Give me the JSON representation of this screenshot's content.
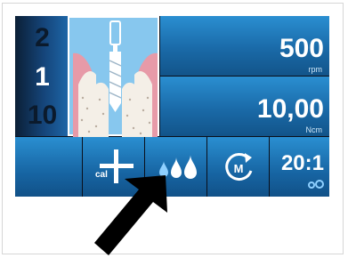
{
  "programs": {
    "top": "2",
    "middle": "1",
    "bottom": "10"
  },
  "speed": {
    "value": "500",
    "unit": "rpm"
  },
  "torque": {
    "value": "10,00",
    "unit": "Ncm"
  },
  "toolbar": {
    "calibration_label": "cal",
    "ratio_value": "20:1"
  },
  "icons": {
    "calibration": "cal-plus-icon",
    "irrigation": "irrigation-drops-icon",
    "motor": "motor-rotation-icon",
    "ratio_settings": "settings-gears-icon",
    "pointer": "pointer-arrow-icon"
  },
  "colors": {
    "panel_blue": "#1e7ac0",
    "screen_bg": "#0a0f1a",
    "illustration_bg": "#87c7ee",
    "gum_pink": "#e79aa8",
    "bone_white": "#f4efe7"
  }
}
